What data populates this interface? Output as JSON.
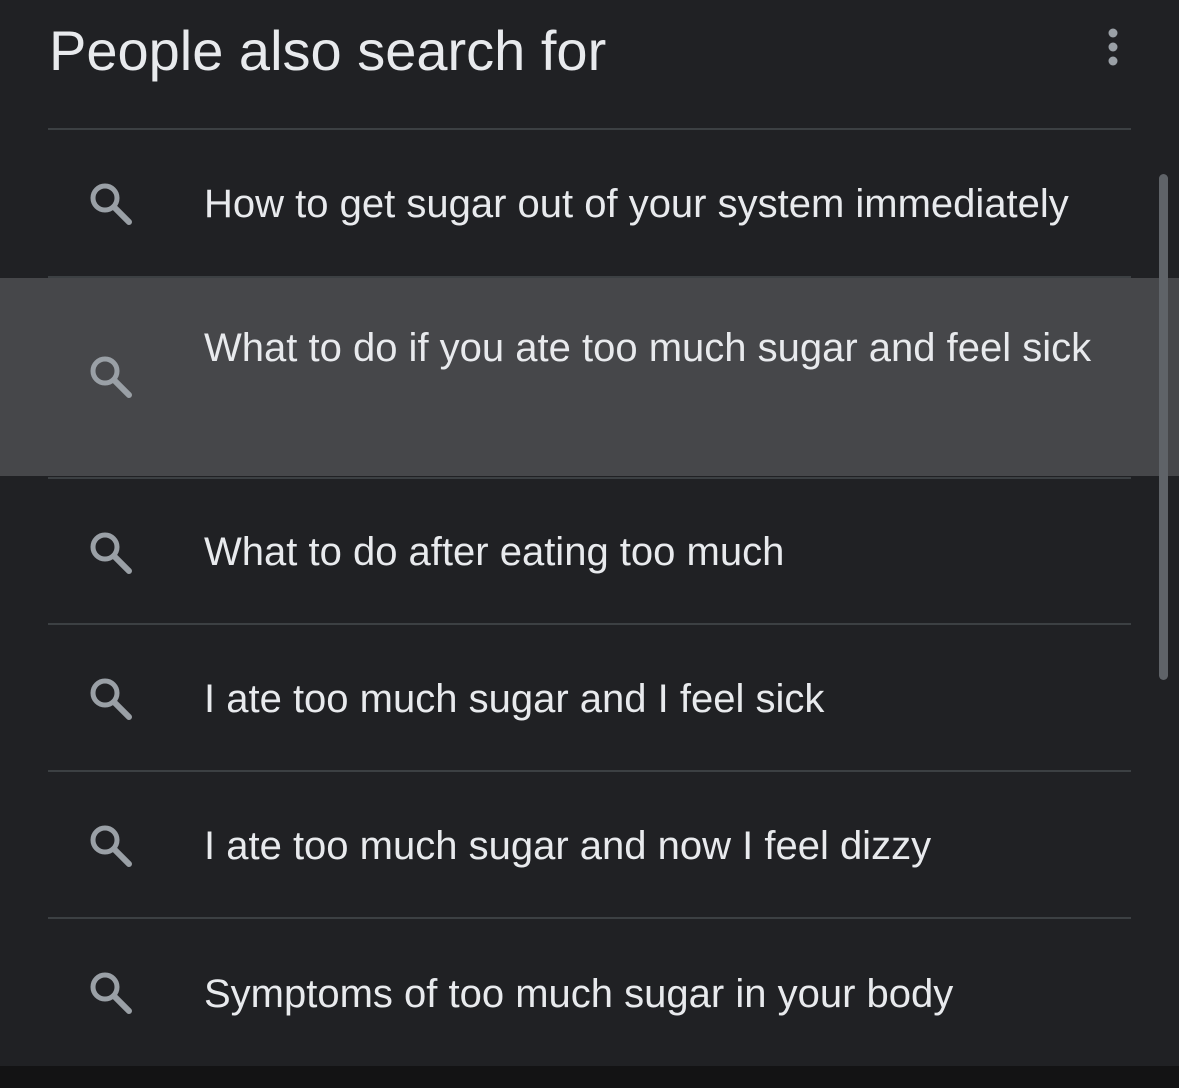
{
  "header": {
    "title": "People also search for",
    "more_icon": "more-vert-icon"
  },
  "suggestions": [
    {
      "text": "How to get sugar out of your system immediately",
      "icon": "search-icon",
      "highlighted": false
    },
    {
      "text": "What to do if you ate too much sugar and feel sick",
      "icon": "search-icon",
      "highlighted": true
    },
    {
      "text": "What to do after eating too much",
      "icon": "search-icon",
      "highlighted": false
    },
    {
      "text": "I ate too much sugar and I feel sick",
      "icon": "search-icon",
      "highlighted": false
    },
    {
      "text": "I ate too much sugar and now I feel dizzy",
      "icon": "search-icon",
      "highlighted": false
    },
    {
      "text": "Symptoms of too much sugar in your body",
      "icon": "search-icon",
      "highlighted": false
    }
  ],
  "colors": {
    "background": "#202124",
    "highlight": "#46474a",
    "text": "#e8eaed",
    "icon": "#9aa0a6",
    "divider": "#3c4043"
  }
}
